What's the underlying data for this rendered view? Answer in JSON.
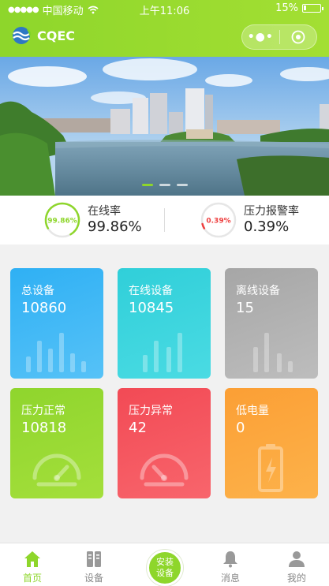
{
  "status_bar": {
    "carrier": "中国移动",
    "time": "上午11:06",
    "battery": "15%",
    "battery_level": 0.15
  },
  "header": {
    "logo_text": "CQEC",
    "capsule_dots_icon": "more-dots-icon",
    "capsule_close_icon": "target-circle-icon"
  },
  "banner": {
    "slide_count": 3,
    "active_slide": 0
  },
  "stats": [
    {
      "label": "在线率",
      "value": "99.86%",
      "ring_text": "99.86%",
      "ring_fraction": 0.9986,
      "color": "#8ed62b"
    },
    {
      "label": "压力报警率",
      "value": "0.39%",
      "ring_text": "0.39%",
      "ring_fraction": 0.0039,
      "color": "#ee3f3f"
    }
  ],
  "cards": [
    {
      "label": "总设备",
      "value": "10860",
      "icon": "bar-chart-icon",
      "color": "#2fb0f4"
    },
    {
      "label": "在线设备",
      "value": "10845",
      "icon": "bar-chart-icon",
      "color": "#30cfd9"
    },
    {
      "label": "离线设备",
      "value": "15",
      "icon": "bar-chart-icon",
      "color": "#a6a6a6"
    },
    {
      "label": "压力正常",
      "value": "10818",
      "icon": "gauge-icon",
      "color": "#8fd52d"
    },
    {
      "label": "压力异常",
      "value": "42",
      "icon": "gauge-icon",
      "color": "#f24a55"
    },
    {
      "label": "低电量",
      "value": "0",
      "icon": "battery-low-icon",
      "color": "#fb9f35"
    }
  ],
  "tabs": [
    {
      "label": "首页",
      "icon": "home-icon",
      "active": true
    },
    {
      "label": "设备",
      "icon": "device-icon",
      "active": false
    },
    {
      "label": "安装\n设备",
      "icon": "install-button",
      "active": false
    },
    {
      "label": "消息",
      "icon": "bell-icon",
      "active": false
    },
    {
      "label": "我的",
      "icon": "user-icon",
      "active": false
    }
  ],
  "colors": {
    "accent": "#8ed62b",
    "alarm": "#ee3f3f"
  }
}
